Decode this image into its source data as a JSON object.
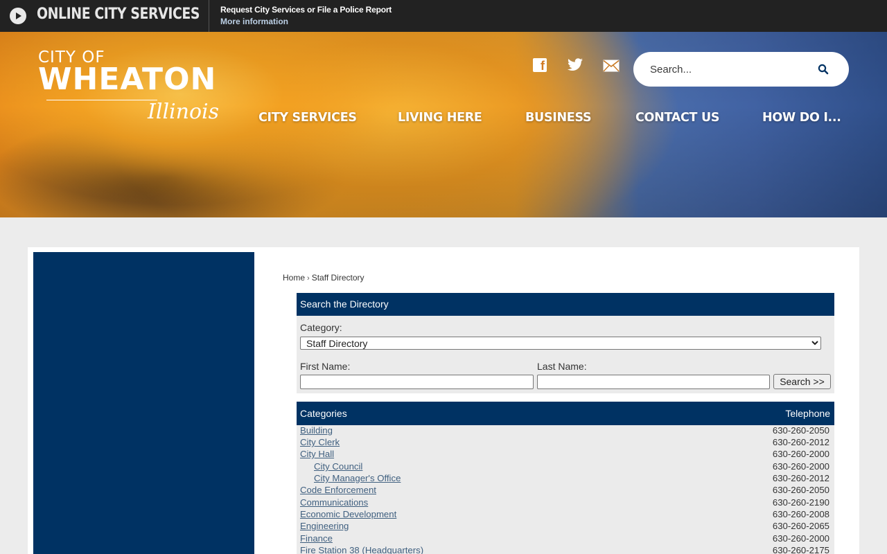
{
  "banner": {
    "title": "ONLINE CITY SERVICES",
    "request_text": "Request City Services or File a Police Report",
    "more_link": "More information"
  },
  "header": {
    "logo_city_of": "CITY OF",
    "logo_wheaton": "WHEATON",
    "logo_illinois": "Illinois",
    "social": [
      "facebook-icon",
      "twitter-icon",
      "email-icon"
    ],
    "search_placeholder": "Search...",
    "nav": [
      "CITY SERVICES",
      "LIVING HERE",
      "BUSINESS",
      "CONTACT US",
      "HOW DO I..."
    ]
  },
  "breadcrumb": {
    "home": "Home",
    "separator": "›",
    "current": "Staff Directory"
  },
  "directory_search": {
    "title": "Search the Directory",
    "category_label": "Category:",
    "category_value": "Staff Directory",
    "first_name_label": "First Name:",
    "last_name_label": "Last Name:",
    "search_button": "Search >>"
  },
  "categories": {
    "header_left": "Categories",
    "header_right": "Telephone",
    "rows": [
      {
        "name": "Building",
        "phone": "630-260-2050",
        "indent": false
      },
      {
        "name": "City Clerk",
        "phone": "630-260-2012",
        "indent": false
      },
      {
        "name": "City Hall",
        "phone": "630-260-2000",
        "indent": false
      },
      {
        "name": "City Council",
        "phone": "630-260-2000",
        "indent": true
      },
      {
        "name": "City Manager's Office",
        "phone": "630-260-2012",
        "indent": true
      },
      {
        "name": "Code Enforcement",
        "phone": "630-260-2050",
        "indent": false
      },
      {
        "name": "Communications",
        "phone": "630-260-2190",
        "indent": false
      },
      {
        "name": "Economic Development",
        "phone": "630-260-2008",
        "indent": false
      },
      {
        "name": "Engineering",
        "phone": "630-260-2065",
        "indent": false
      },
      {
        "name": "Finance",
        "phone": "630-260-2000",
        "indent": false
      },
      {
        "name": "Fire Station 38 (Headquarters)",
        "phone": "630-260-2175",
        "indent": false
      }
    ]
  },
  "colors": {
    "navy": "#003263",
    "topbar": "#222222",
    "link": "#3f5f7f",
    "page_bg": "#ececec"
  }
}
